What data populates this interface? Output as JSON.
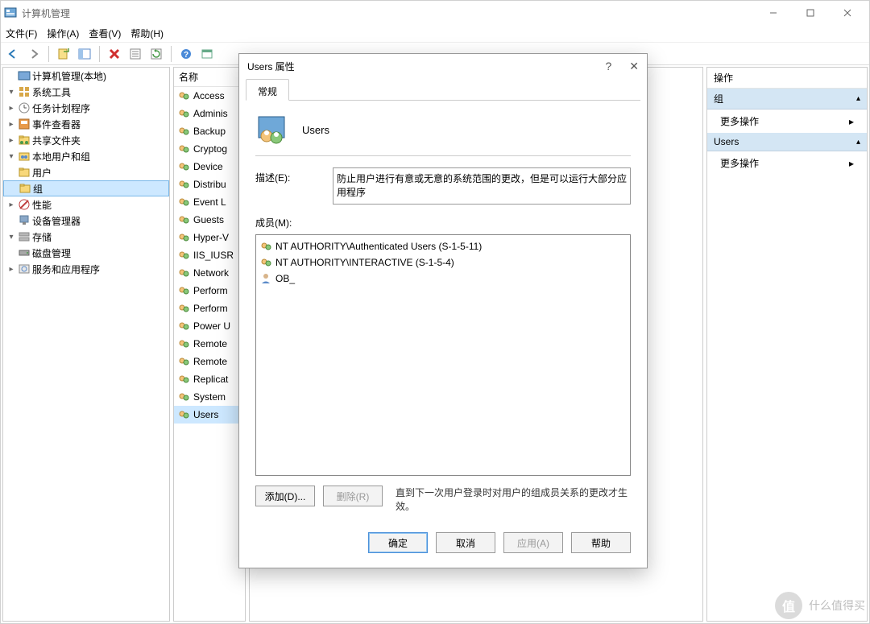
{
  "window": {
    "title": "计算机管理"
  },
  "menu": {
    "file": "文件(F)",
    "action": "操作(A)",
    "view": "查看(V)",
    "help": "帮助(H)"
  },
  "tree": {
    "root": "计算机管理(本地)",
    "sys_tools": "系统工具",
    "task_scheduler": "任务计划程序",
    "event_viewer": "事件查看器",
    "shared_folders": "共享文件夹",
    "local_users": "本地用户和组",
    "users_node": "用户",
    "groups_node": "组",
    "performance": "性能",
    "device_manager": "设备管理器",
    "storage": "存储",
    "disk_mgmt": "磁盘管理",
    "services_apps": "服务和应用程序"
  },
  "list": {
    "header": "名称",
    "items": [
      "Access ",
      "Adminis",
      "Backup ",
      "Cryptog",
      "Device ",
      "Distribu",
      "Event L",
      "Guests",
      "Hyper-V",
      "IIS_IUSR",
      "Network",
      "Perform",
      "Perform",
      "Power U",
      "Remote",
      "Remote",
      "Replicat",
      "System ",
      "Users"
    ]
  },
  "actions": {
    "header": "操作",
    "group_label": "组",
    "more_actions": "更多操作",
    "users_label": "Users"
  },
  "dialog": {
    "title": "Users 属性",
    "tab_general": "常规",
    "group_name": "Users",
    "desc_label": "描述(E):",
    "desc_value": "防止用户进行有意或无意的系统范围的更改，但是可以运行大部分应用程序",
    "members_label": "成员(M):",
    "members": [
      "NT AUTHORITY\\Authenticated Users (S-1-5-11)",
      "NT AUTHORITY\\INTERACTIVE (S-1-5-4)",
      "OB_"
    ],
    "add_btn": "添加(D)...",
    "remove_btn": "删除(R)",
    "note": "直到下一次用户登录时对用户的组成员关系的更改才生效。",
    "ok": "确定",
    "cancel": "取消",
    "apply": "应用(A)",
    "help": "帮助"
  },
  "watermark": {
    "badge": "值",
    "text": "什么值得买"
  }
}
